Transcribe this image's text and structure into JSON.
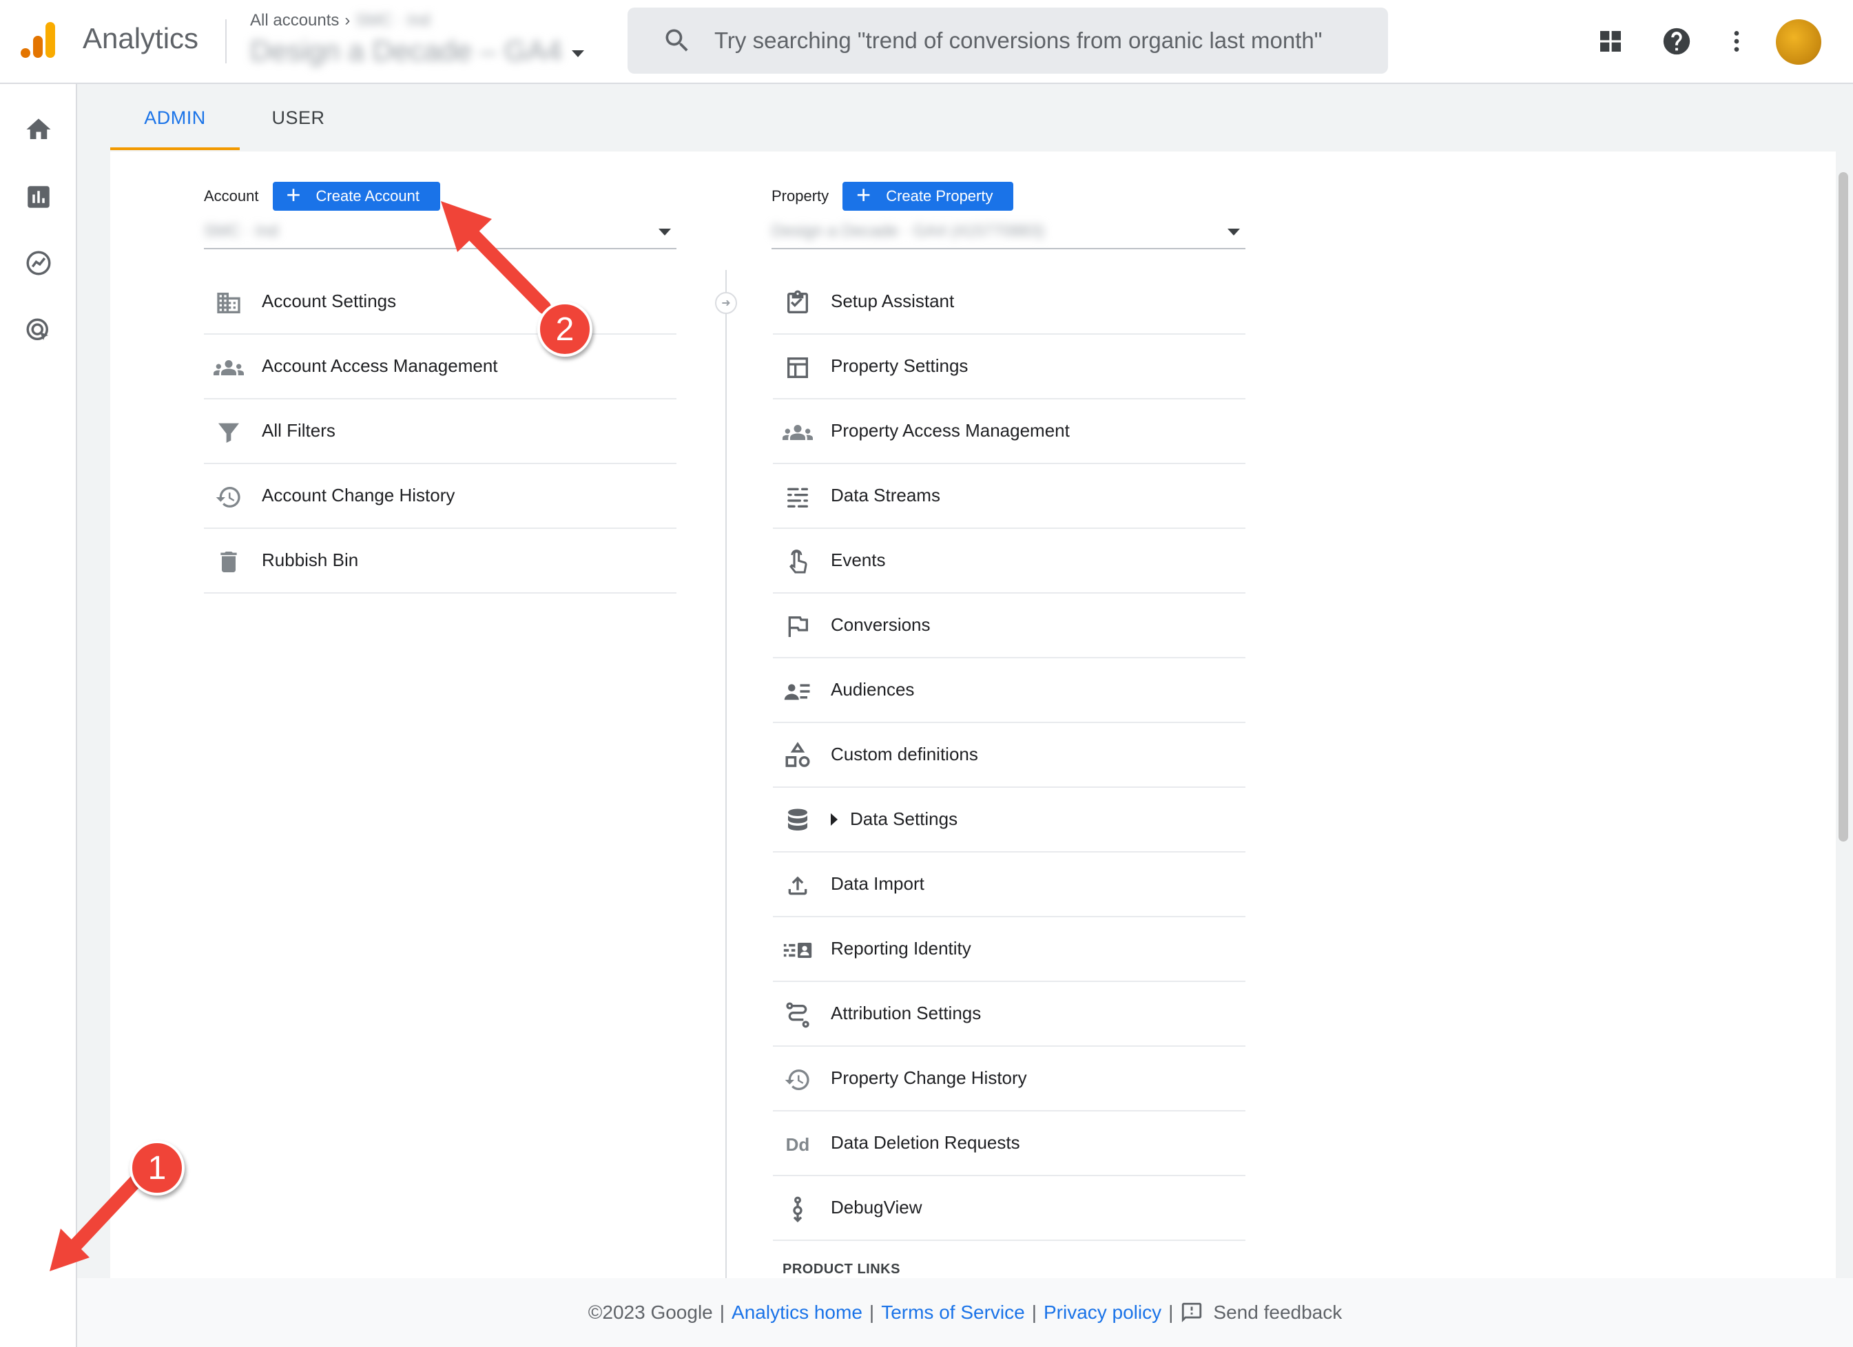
{
  "app": {
    "name": "Analytics"
  },
  "breadcrumb": {
    "root": "All accounts",
    "account": "SMC · Ind",
    "property": "Design a Decade – GA4"
  },
  "search": {
    "placeholder": "Try searching \"trend of conversions from organic last month\""
  },
  "tabs": [
    {
      "label": "ADMIN",
      "active": true
    },
    {
      "label": "USER",
      "active": false
    }
  ],
  "account_column": {
    "label": "Account",
    "create_button": "Create Account",
    "selected": "SMC · Ind",
    "items": [
      {
        "label": "Account Settings",
        "icon": "building-icon"
      },
      {
        "label": "Account Access Management",
        "icon": "people-icon"
      },
      {
        "label": "All Filters",
        "icon": "filter-icon"
      },
      {
        "label": "Account Change History",
        "icon": "history-icon"
      },
      {
        "label": "Rubbish Bin",
        "icon": "trash-icon"
      }
    ]
  },
  "property_column": {
    "label": "Property",
    "create_button": "Create Property",
    "selected": "Design a Decade · GA4 (415770883)",
    "items": [
      {
        "label": "Setup Assistant",
        "icon": "checklist-icon"
      },
      {
        "label": "Property Settings",
        "icon": "layout-icon"
      },
      {
        "label": "Property Access Management",
        "icon": "people-icon"
      },
      {
        "label": "Data Streams",
        "icon": "streams-icon"
      },
      {
        "label": "Events",
        "icon": "touch-icon"
      },
      {
        "label": "Conversions",
        "icon": "flag-icon"
      },
      {
        "label": "Audiences",
        "icon": "audience-icon"
      },
      {
        "label": "Custom definitions",
        "icon": "shapes-icon"
      },
      {
        "label": "Data Settings",
        "icon": "database-icon"
      },
      {
        "label": "Data Import",
        "icon": "upload-icon"
      },
      {
        "label": "Reporting Identity",
        "icon": "identity-icon"
      },
      {
        "label": "Attribution Settings",
        "icon": "attribution-icon"
      },
      {
        "label": "Property Change History",
        "icon": "history-icon"
      },
      {
        "label": "Data Deletion Requests",
        "icon": "dd-icon"
      },
      {
        "label": "DebugView",
        "icon": "debug-icon"
      }
    ],
    "section_heading": "PRODUCT LINKS"
  },
  "footer": {
    "copyright": "©2023 Google",
    "links": [
      "Analytics home",
      "Terms of Service",
      "Privacy policy"
    ],
    "feedback": "Send feedback"
  },
  "callouts": [
    "1",
    "2"
  ],
  "colors": {
    "accent": "#1a73e8",
    "tab_underline": "#f29900",
    "callout": "#f04438"
  }
}
